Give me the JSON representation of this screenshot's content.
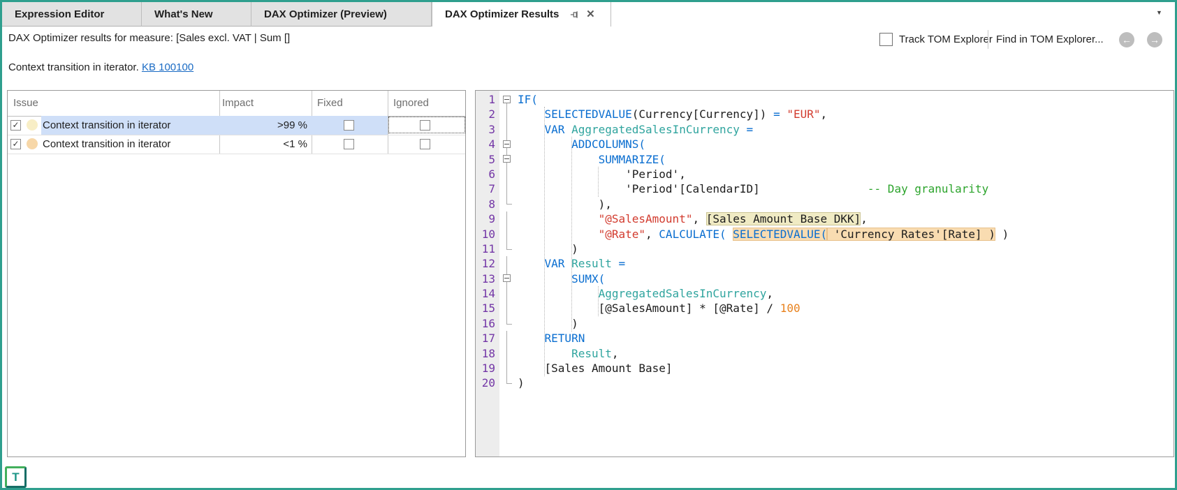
{
  "palette": {
    "accent_teal": "#2f9f8e",
    "selection_blue": "#cfdff8",
    "highlight_yellow": "#f0ebc4",
    "highlight_orange": "#f9dcb1",
    "link_blue": "#1a6bc4"
  },
  "tabs": [
    {
      "label": "Expression Editor",
      "active": false
    },
    {
      "label": "What's New",
      "active": false
    },
    {
      "label": "DAX Optimizer (Preview)",
      "active": false
    },
    {
      "label": "DAX Optimizer Results",
      "active": true
    }
  ],
  "toolbar": {
    "result_text": "DAX Optimizer results for measure: [Sales excl. VAT | Sum []",
    "track_label": "Track TOM Explorer",
    "track_checked": false,
    "find_label": "Find in TOM Explorer...",
    "back_arrow": "←",
    "forward_arrow": "→",
    "overflow_caret": "▼"
  },
  "issue_summary": {
    "text": "Context transition in iterator. ",
    "link": "KB 100100"
  },
  "table": {
    "columns": [
      "Issue",
      "Impact",
      "Fixed",
      "Ignored"
    ],
    "rows": [
      {
        "enabled": true,
        "dot_color": "#f8eec6",
        "issue": "Context transition in iterator",
        "impact": ">99 %",
        "fixed": false,
        "ignored": false,
        "selected": true
      },
      {
        "enabled": true,
        "dot_color": "#f7d7a8",
        "issue": "Context transition in iterator",
        "impact": "<1 %",
        "fixed": false,
        "ignored": false,
        "selected": false
      }
    ]
  },
  "editor": {
    "lines": [
      {
        "n": 1,
        "fold": "box",
        "tokens": [
          {
            "c": "kw",
            "t": "IF("
          }
        ]
      },
      {
        "n": 2,
        "fold": "line",
        "tokens": [
          {
            "c": "pl",
            "t": "    "
          },
          {
            "c": "kw",
            "t": "SELECTEDVALUE"
          },
          {
            "c": "pl",
            "t": "(Currency[Currency]) "
          },
          {
            "c": "kw",
            "t": "="
          },
          {
            "c": "pl",
            "t": " "
          },
          {
            "c": "str",
            "t": "\"EUR\""
          },
          {
            "c": "pl",
            "t": ","
          }
        ]
      },
      {
        "n": 3,
        "fold": "line",
        "tokens": [
          {
            "c": "pl",
            "t": "    "
          },
          {
            "c": "kw",
            "t": "VAR"
          },
          {
            "c": "pl",
            "t": " "
          },
          {
            "c": "var",
            "t": "AggregatedSalesInCurrency"
          },
          {
            "c": "pl",
            "t": " "
          },
          {
            "c": "kw",
            "t": "="
          }
        ]
      },
      {
        "n": 4,
        "fold": "box",
        "tokens": [
          {
            "c": "pl",
            "t": "        "
          },
          {
            "c": "kw",
            "t": "ADDCOLUMNS("
          }
        ]
      },
      {
        "n": 5,
        "fold": "box",
        "tokens": [
          {
            "c": "pl",
            "t": "            "
          },
          {
            "c": "kw",
            "t": "SUMMARIZE("
          }
        ]
      },
      {
        "n": 6,
        "fold": "line",
        "tokens": [
          {
            "c": "pl",
            "t": "                'Period',"
          }
        ]
      },
      {
        "n": 7,
        "fold": "line",
        "tokens": [
          {
            "c": "pl",
            "t": "                'Period'[CalendarID]                "
          },
          {
            "c": "com",
            "t": "-- Day granularity"
          }
        ]
      },
      {
        "n": 8,
        "fold": "corner",
        "tokens": [
          {
            "c": "pl",
            "t": "            ),"
          }
        ]
      },
      {
        "n": 9,
        "fold": "line",
        "tokens": [
          {
            "c": "pl",
            "t": "            "
          },
          {
            "c": "str",
            "t": "\"@SalesAmount\""
          },
          {
            "c": "pl",
            "t": ", "
          },
          {
            "c": "pl",
            "h": "y",
            "t": "[Sales Amount Base DKK]"
          },
          {
            "c": "pl",
            "t": ","
          }
        ]
      },
      {
        "n": 10,
        "fold": "line",
        "tokens": [
          {
            "c": "pl",
            "t": "            "
          },
          {
            "c": "str",
            "t": "\"@Rate\""
          },
          {
            "c": "pl",
            "t": ", "
          },
          {
            "c": "kw",
            "t": "CALCULATE("
          },
          {
            "c": "pl",
            "t": " "
          },
          {
            "c": "kw",
            "h": "o",
            "t": "SELECTEDVALUE("
          },
          {
            "c": "pl",
            "h": "o",
            "t": " 'Currency Rates'[Rate] )"
          },
          {
            "c": "pl",
            "t": " )"
          }
        ]
      },
      {
        "n": 11,
        "fold": "corner",
        "tokens": [
          {
            "c": "pl",
            "t": "        )"
          }
        ]
      },
      {
        "n": 12,
        "fold": "line",
        "tokens": [
          {
            "c": "pl",
            "t": "    "
          },
          {
            "c": "kw",
            "t": "VAR"
          },
          {
            "c": "pl",
            "t": " "
          },
          {
            "c": "var",
            "t": "Result"
          },
          {
            "c": "pl",
            "t": " "
          },
          {
            "c": "kw",
            "t": "="
          }
        ]
      },
      {
        "n": 13,
        "fold": "box",
        "tokens": [
          {
            "c": "pl",
            "t": "        "
          },
          {
            "c": "kw",
            "t": "SUMX("
          }
        ]
      },
      {
        "n": 14,
        "fold": "line",
        "tokens": [
          {
            "c": "pl",
            "t": "            "
          },
          {
            "c": "var",
            "t": "AggregatedSalesInCurrency"
          },
          {
            "c": "pl",
            "t": ","
          }
        ]
      },
      {
        "n": 15,
        "fold": "line",
        "tokens": [
          {
            "c": "pl",
            "t": "            [@SalesAmount] * [@Rate] / "
          },
          {
            "c": "num",
            "t": "100"
          }
        ]
      },
      {
        "n": 16,
        "fold": "corner",
        "tokens": [
          {
            "c": "pl",
            "t": "        )"
          }
        ]
      },
      {
        "n": 17,
        "fold": "line",
        "tokens": [
          {
            "c": "pl",
            "t": "    "
          },
          {
            "c": "kw",
            "t": "RETURN"
          }
        ]
      },
      {
        "n": 18,
        "fold": "line",
        "tokens": [
          {
            "c": "pl",
            "t": "        "
          },
          {
            "c": "var",
            "t": "Result"
          },
          {
            "c": "pl",
            "t": ","
          }
        ]
      },
      {
        "n": 19,
        "fold": "line",
        "tokens": [
          {
            "c": "pl",
            "t": "    [Sales Amount Base]"
          }
        ]
      },
      {
        "n": 20,
        "fold": "corner",
        "tokens": [
          {
            "c": "pl",
            "t": ")"
          }
        ]
      }
    ]
  },
  "logo": {
    "letter": "T"
  }
}
